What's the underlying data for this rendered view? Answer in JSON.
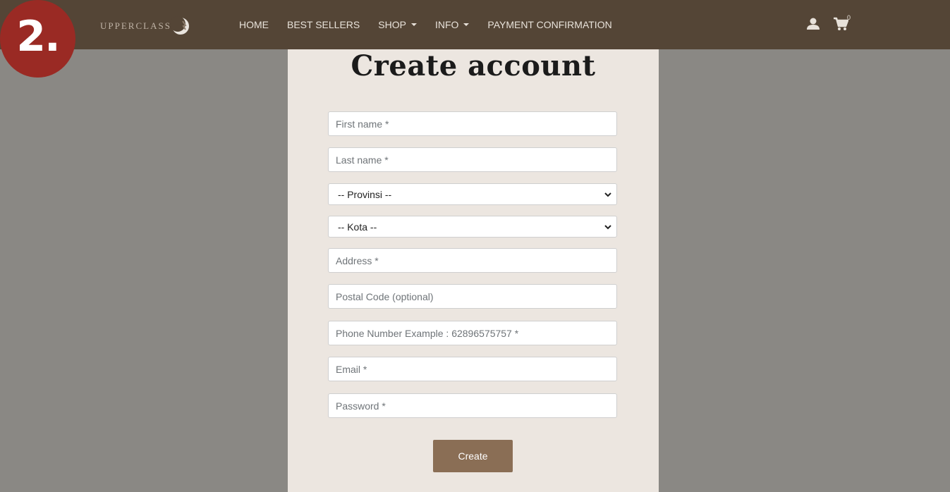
{
  "step_badge": "2.",
  "header": {
    "logo_text": "UPPERCLASS",
    "nav": [
      {
        "label": "HOME"
      },
      {
        "label": "BEST SELLERS"
      },
      {
        "label": "SHOP"
      },
      {
        "label": "INFO"
      },
      {
        "label": "PAYMENT CONFIRMATION"
      }
    ],
    "cart_count": "0"
  },
  "form": {
    "title": "Create account",
    "first_name": {
      "placeholder": "First name *",
      "value": ""
    },
    "last_name": {
      "placeholder": "Last name *",
      "value": ""
    },
    "province": {
      "selected": "-- Provinsi --"
    },
    "city": {
      "selected": "-- Kota --"
    },
    "address": {
      "placeholder": "Address *",
      "value": ""
    },
    "postal_code": {
      "placeholder": "Postal Code (optional)",
      "value": ""
    },
    "phone": {
      "placeholder": "Phone Number Example : 62896575757 *",
      "value": ""
    },
    "email": {
      "placeholder": "Email *",
      "value": ""
    },
    "password": {
      "placeholder": "Password *",
      "value": ""
    },
    "submit_label": "Create"
  },
  "colors": {
    "header_bg": "#544536",
    "page_bg": "#8a8884",
    "panel_bg": "#ece6e0",
    "button_bg": "#8a6e55",
    "badge_bg": "#9a2a24"
  },
  "icons": [
    "user-icon",
    "cart-icon",
    "chevron-down-icon",
    "caret-down-icon",
    "logo-crescent-icon"
  ]
}
